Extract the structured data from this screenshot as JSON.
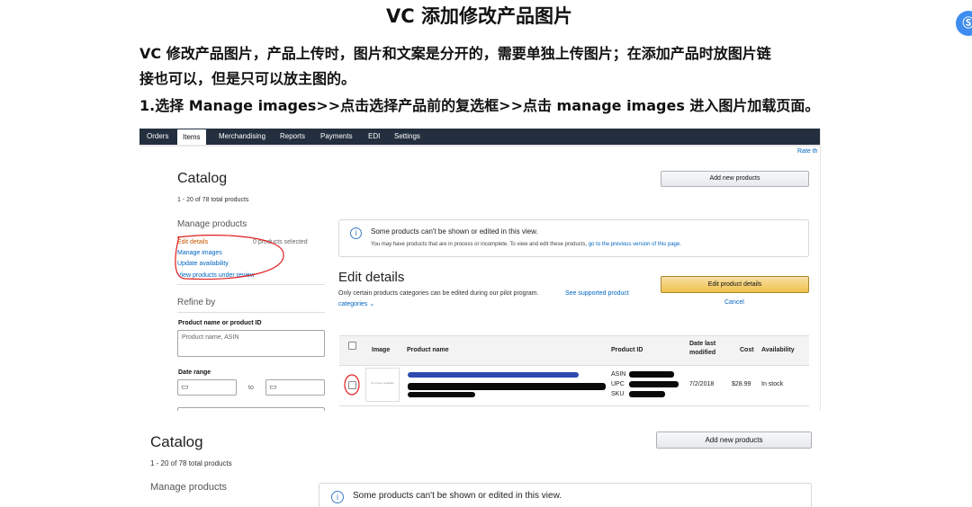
{
  "doc": {
    "title": "VC 添加修改产品图片",
    "para1_line1": "VC 修改产品图片，产品上传时，图片和文案是分开的，需要单独上传图片；在添加产品时放图片链",
    "para1_line2": "接也可以，但是只可以放主图的。",
    "para2": "1.选择 Manage images>>点击选择产品前的复选框>>点击 manage images 进入图片加载页面。",
    "side_button": "Ⓢ"
  },
  "shot1": {
    "nav": [
      "Orders",
      "Items",
      "Merchandising",
      "Reports",
      "Payments",
      "EDI",
      "Settings"
    ],
    "nav_active": "Items",
    "rate_link": "Rate th",
    "catalog_title": "Catalog",
    "count": "1 - 20 of 78 total products",
    "add_button": "Add new products",
    "manage_heading": "Manage products",
    "manage_links": [
      "Edit details",
      "Manage images",
      "Update availability",
      "View products under review"
    ],
    "selected_text": "0 products selected",
    "refine_heading": "Refine by",
    "product_field_label": "Product name or product ID",
    "product_field_placeholder": "Product name, ASIN",
    "date_range_label": "Date range",
    "date_to": "to",
    "info_title": "Some products can't be shown or edited in this view.",
    "info_body": "You may have products that are in process or incomplete. To view and edit these products,",
    "info_link": "go to the previous version of this page",
    "info_end": ".",
    "edit_heading": "Edit details",
    "edit_desc": "Only certain products categories can be edited during our pilot program.",
    "edit_desc_link": "See supported product",
    "edit_desc_link2": "categories ⌄",
    "edit_button": "Edit product details",
    "cancel": "Cancel",
    "columns": {
      "image": "Image",
      "name": "Product name",
      "id": "Product ID",
      "date_l1": "Date last",
      "date_l2": "modified",
      "cost": "Cost",
      "availability": "Availability"
    },
    "row": {
      "thumb_text": "No image available",
      "asin": "ASIN",
      "upc": "UPC",
      "sku": "SKU",
      "date": "7/2/2018",
      "cost": "$28.99",
      "availability": "In stock"
    }
  },
  "shot2": {
    "catalog_title": "Catalog",
    "count": "1 - 20 of 78 total products",
    "add_button": "Add new products",
    "manage_heading": "Manage products",
    "info_title": "Some products can't be shown or edited in this view."
  },
  "colors": {
    "nav_bg": "#232f3e",
    "link": "#0066c0",
    "edit_link": "#c45500",
    "annotation": "#e11d1d",
    "yellow_button": "#f0c14b"
  }
}
